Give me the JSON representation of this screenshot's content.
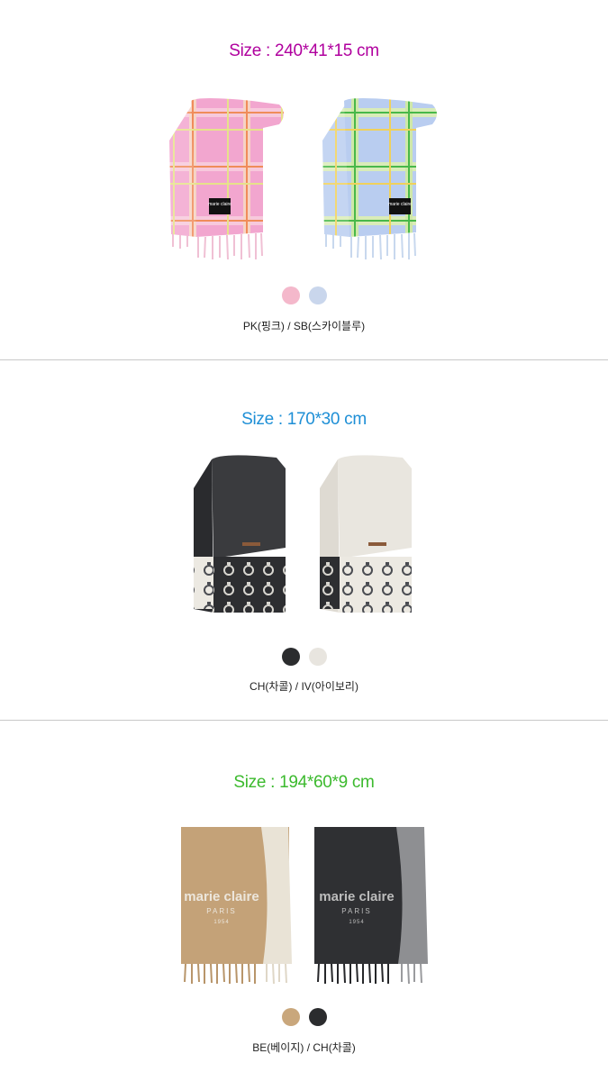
{
  "sections": [
    {
      "size_text": "Size : 240*41*15 cm",
      "size_color": "#b0009e",
      "swatches": [
        "#f4b8cb",
        "#c9d6ec"
      ],
      "color_label": "PK(핑크) / SB(스카이블루)",
      "scarf_label": "marie claire"
    },
    {
      "size_text": "Size : 170*30 cm",
      "size_color": "#1e8fd6",
      "swatches": [
        "#2b2c2e",
        "#e8e5df"
      ],
      "color_label": "CH(차콜)  / IV(아이보리)"
    },
    {
      "size_text": "Size : 194*60*9 cm",
      "size_color": "#3cba2e",
      "swatches": [
        "#c9a77c",
        "#2b2c2e"
      ],
      "color_label": "BE(베이지) / CH(차콜)",
      "scarf_brand": "marie claire",
      "scarf_city": "PARIS",
      "scarf_year": "1954"
    }
  ]
}
